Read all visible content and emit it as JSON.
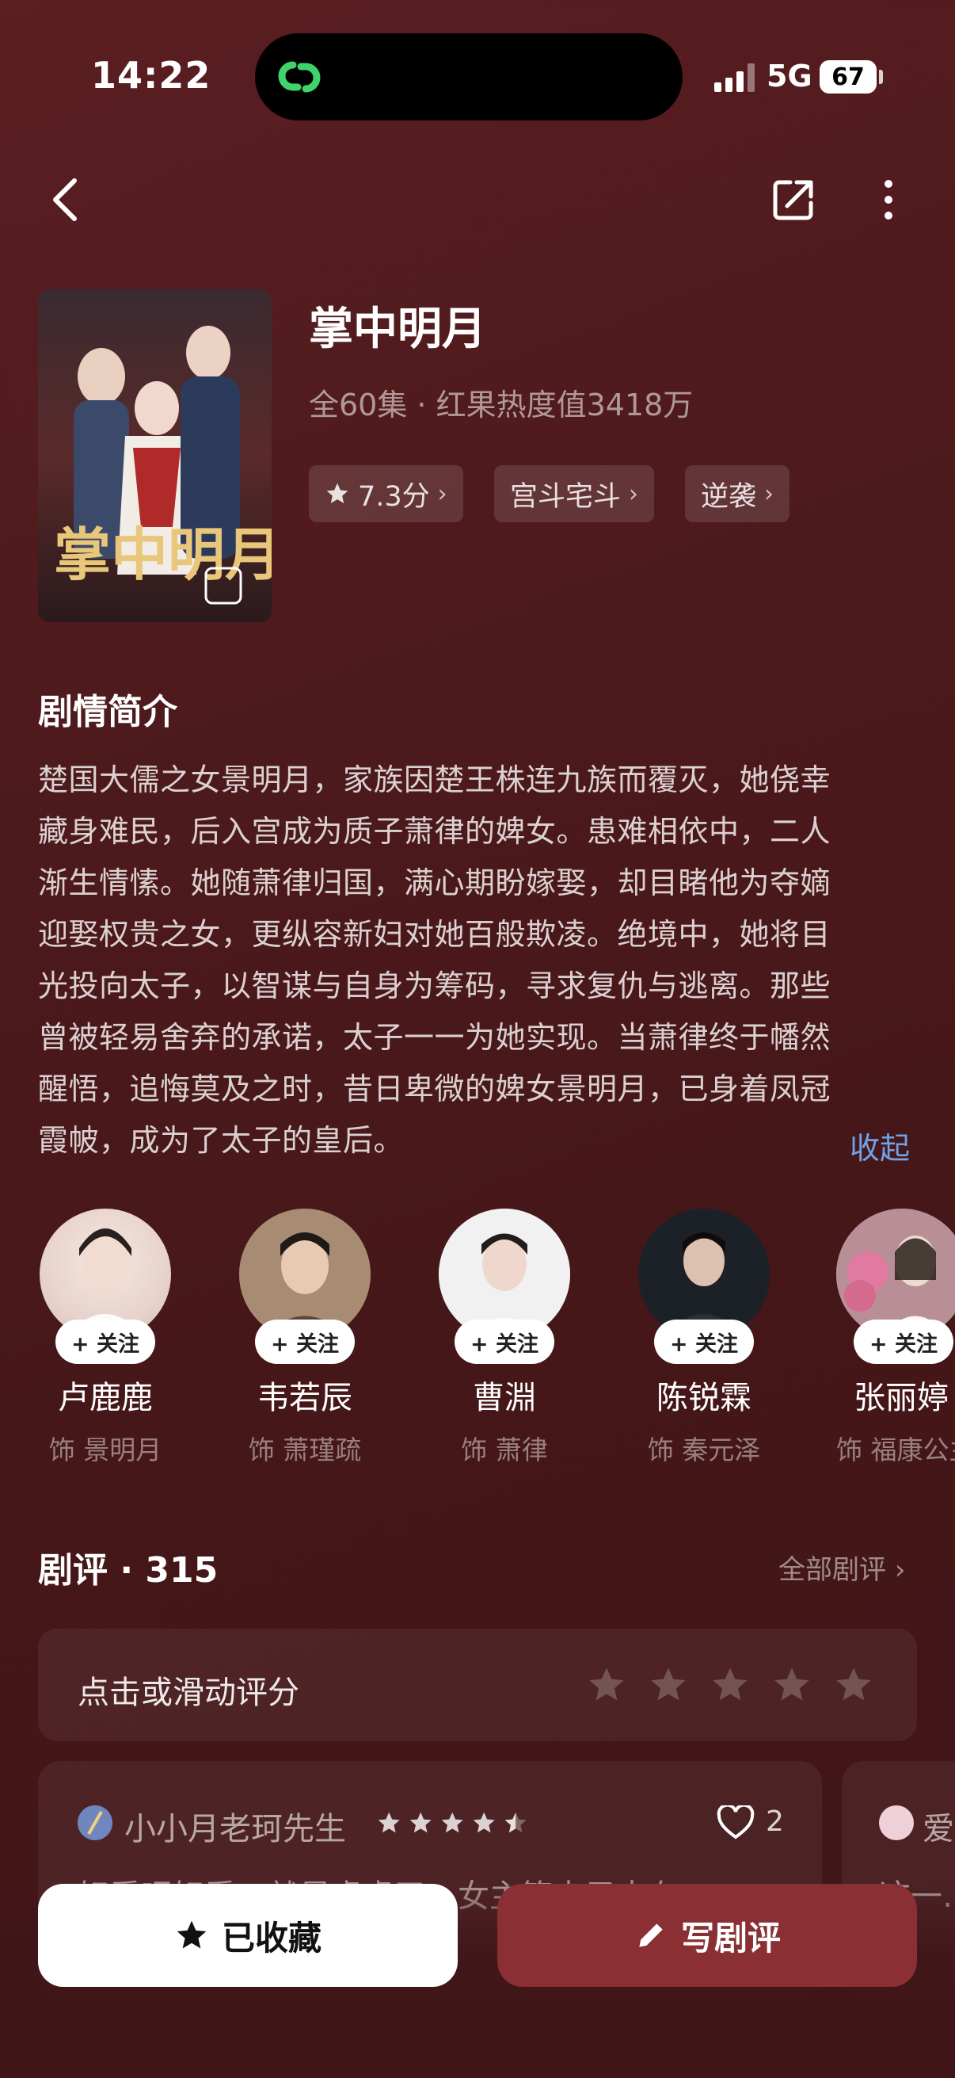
{
  "status": {
    "time": "14:22",
    "network": "5G",
    "battery": "67"
  },
  "show": {
    "title": "掌中明月",
    "subtitle": "全60集 · 红果热度值3418万",
    "tags": [
      {
        "label": "7.3分",
        "icon": "star-icon"
      },
      {
        "label": "宫斗宅斗"
      },
      {
        "label": "逆袭"
      }
    ]
  },
  "synopsis": {
    "heading": "剧情简介",
    "lines": [
      "楚国大儒之女景明月，家族因楚王株连九族而覆灭，她侥幸",
      "藏身难民，后入宫成为质子萧律的婢女。患难相依中，二人",
      "渐生情愫。她随萧律归国，满心期盼嫁娶，却目睹他为夺嫡",
      "迎娶权贵之女，更纵容新妇对她百般欺凌。绝境中，她将目",
      "光投向太子，以智谋与自身为筹码，寻求复仇与逃离。那些",
      "曾被轻易舍弃的承诺，太子一一为她实现。当萧律终于幡然",
      "醒悟，追悔莫及之时，昔日卑微的婢女景明月，已身着凤冠",
      "霞帔，成为了太子的皇后。"
    ],
    "collapse_label": "收起"
  },
  "cast": [
    {
      "name": "卢鹿鹿",
      "role": "饰 景明月",
      "follow": "+ 关注"
    },
    {
      "name": "韦若辰",
      "role": "饰 萧瑾疏",
      "follow": "+ 关注"
    },
    {
      "name": "曹淵",
      "role": "饰 萧律",
      "follow": "+ 关注"
    },
    {
      "name": "陈锐霖",
      "role": "饰 秦元泽",
      "follow": "+ 关注"
    },
    {
      "name": "张丽婷",
      "role": "饰 福康公主",
      "follow": "+ 关注"
    }
  ],
  "reviews": {
    "heading": "剧评 · 315",
    "all_label": "全部剧评",
    "rate_prompt": "点击或滑动评分",
    "items": [
      {
        "user": "小小月老珂先生",
        "likes": "2",
        "preview": "好看呢好看，就是虐虐了，女主等太子去在…"
      },
      {
        "user": "爱",
        "preview": "这一…"
      }
    ]
  },
  "actions": {
    "collect_label": "已收藏",
    "write_label": "写剧评"
  },
  "colors": {
    "bg": "#4e1a1d",
    "accent": "#8a2f33",
    "link": "#6fa3e8"
  }
}
